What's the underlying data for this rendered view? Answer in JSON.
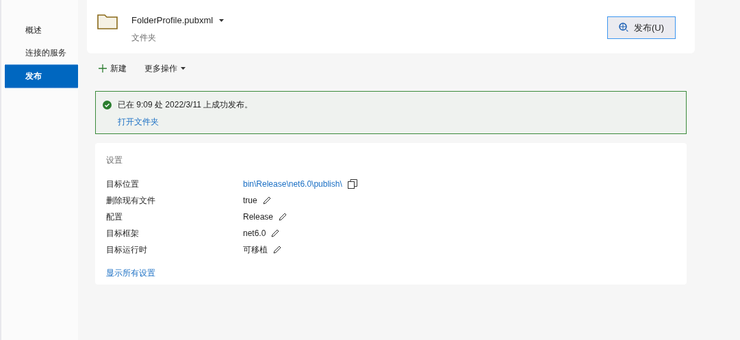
{
  "sidebar": {
    "items": [
      {
        "label": "概述",
        "selected": false
      },
      {
        "label": "连接的服务",
        "selected": false
      },
      {
        "label": "发布",
        "selected": true
      }
    ]
  },
  "profile": {
    "name": "FolderProfile.pubxml",
    "subtitle": "文件夹",
    "publish_button": "发布(U)"
  },
  "toolbar": {
    "new": "新建",
    "more": "更多操作"
  },
  "status": {
    "message": "已在 9:09 处 2022/3/11 上成功发布。",
    "link": "打开文件夹"
  },
  "settings": {
    "title": "设置",
    "rows": [
      {
        "label": "目标位置",
        "value": "bin\\Release\\net6.0\\publish\\",
        "kind": "link"
      },
      {
        "label": "删除现有文件",
        "value": "true",
        "kind": "edit"
      },
      {
        "label": "配置",
        "value": "Release",
        "kind": "edit"
      },
      {
        "label": "目标框架",
        "value": "net6.0",
        "kind": "edit"
      },
      {
        "label": "目标运行时",
        "value": "可移植",
        "kind": "edit"
      }
    ],
    "show_all": "显示所有设置"
  }
}
